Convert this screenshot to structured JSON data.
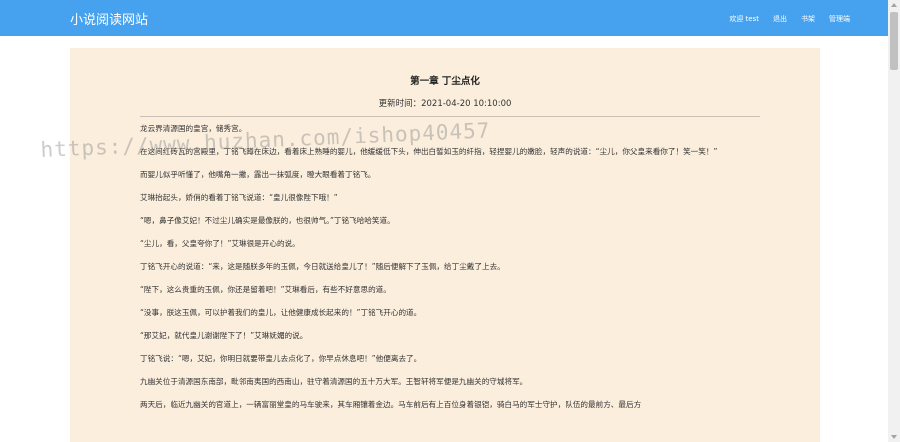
{
  "header": {
    "site_title": "小说阅读网站",
    "nav": [
      {
        "label": "欢迎 test"
      },
      {
        "label": "退出"
      },
      {
        "label": "书架"
      },
      {
        "label": "管理端"
      }
    ]
  },
  "chapter": {
    "title": "第一章 丁尘点化",
    "update_time": "更新时间：2021-04-20 10:10:00",
    "paragraphs": [
      "龙云界清源国的皇宫，储秀宫。",
      "在这间红砖瓦的宫殿里，丁铭飞蹲在床边，看着床上熟睡的婴儿，他缓缓低下头，伸出白皙如玉的纤指，轻捏婴儿的嫩脸，轻声的说道：“尘儿，你父皇来看你了！笑一笑！”",
      "而婴儿似乎听懂了，他嘴角一撇，露出一抹弧度，瞪大眼看着丁铭飞。",
      "艾琳抬起头，娇俏的看着丁铭飞说道：“皇儿很像陛下哦！”",
      "“嗯，鼻子像艾妃！不过尘儿确实是最像朕的，也很帅气。”丁铭飞哈哈笑道。",
      "“尘儿，看，父皇夸你了！”艾琳很是开心的说。",
      "丁铭飞开心的说道：“来，这是随朕多年的玉佩，今日就送给皇儿了！”随后便解下了玉佩，给丁尘戴了上去。",
      "“陛下，这么贵重的玉佩，你还是留着吧！”艾琳看后，有些不好意思的道。",
      "“没事，朕这玉佩，可以护着我们的皇儿，让他健康成长起来的！”丁铭飞开心的道。",
      "“那艾妃，就代皇儿谢谢陛下了！”艾琳妩媚的说。",
      "丁铭飞说：“嗯，艾妃，你明日就要带皇儿去点化了，你早点休息吧！”他便离去了。",
      "九幽关位于清源国东南部，毗邻南夷国的西南山，驻守着清源国的五十万大军。王智轩将军便是九幽关的守城将军。",
      "两天后，临近九幽关的官道上，一辆富丽堂皇的马车驶来，其车厢镶着金边。马车前后有上百位身着银铠，骑白马的军士守护，队伍的最前方、最后方"
    ]
  },
  "watermark": "https://www.huzhan.com/ishop40457"
}
